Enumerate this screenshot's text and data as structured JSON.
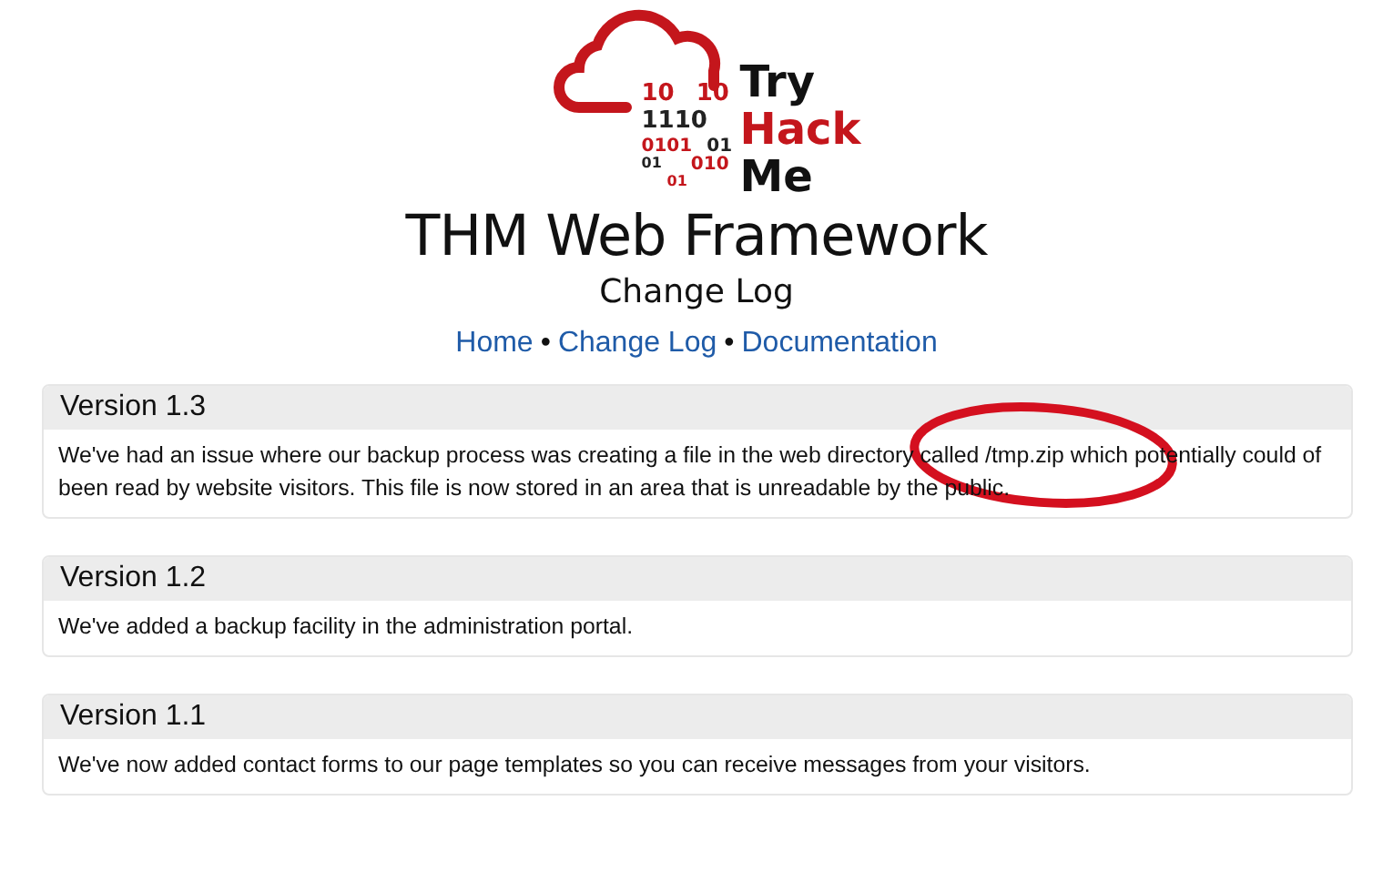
{
  "logo": {
    "binary_rows": [
      [
        {
          "text": "10",
          "color": "#c4161c"
        },
        {
          "text": "10",
          "color": "#c4161c"
        }
      ],
      [
        {
          "text": "1110",
          "color": "#222222"
        }
      ],
      [
        {
          "text": "0101",
          "color": "#c4161c"
        },
        {
          "text": "01",
          "color": "#222222"
        }
      ],
      [
        {
          "text": "01",
          "color": "#222222"
        },
        {
          "text": "010",
          "color": "#c4161c"
        }
      ],
      [
        {
          "text": "01",
          "color": "#c4161c"
        }
      ]
    ],
    "words": [
      {
        "text": "Try",
        "color": "#111111"
      },
      {
        "text": "Hack",
        "color": "#c4161c"
      },
      {
        "text": "Me",
        "color": "#111111"
      }
    ]
  },
  "title": "THM Web Framework",
  "subtitle": "Change Log",
  "nav": {
    "links": [
      "Home",
      "Change Log",
      "Documentation"
    ],
    "separator": "•"
  },
  "versions": [
    {
      "title": "Version 1.3",
      "text": "We've had an issue where our backup process was creating a file in the web directory called /tmp.zip which potentially could of been read by website visitors. This file is now stored in an area that is unreadable by the public.",
      "annotated": true
    },
    {
      "title": "Version 1.2",
      "text": "We've added a backup facility in the administration portal.",
      "annotated": false
    },
    {
      "title": "Version 1.1",
      "text": "We've now added contact forms to our page templates so you can receive messages from your visitors.",
      "annotated": false
    }
  ]
}
